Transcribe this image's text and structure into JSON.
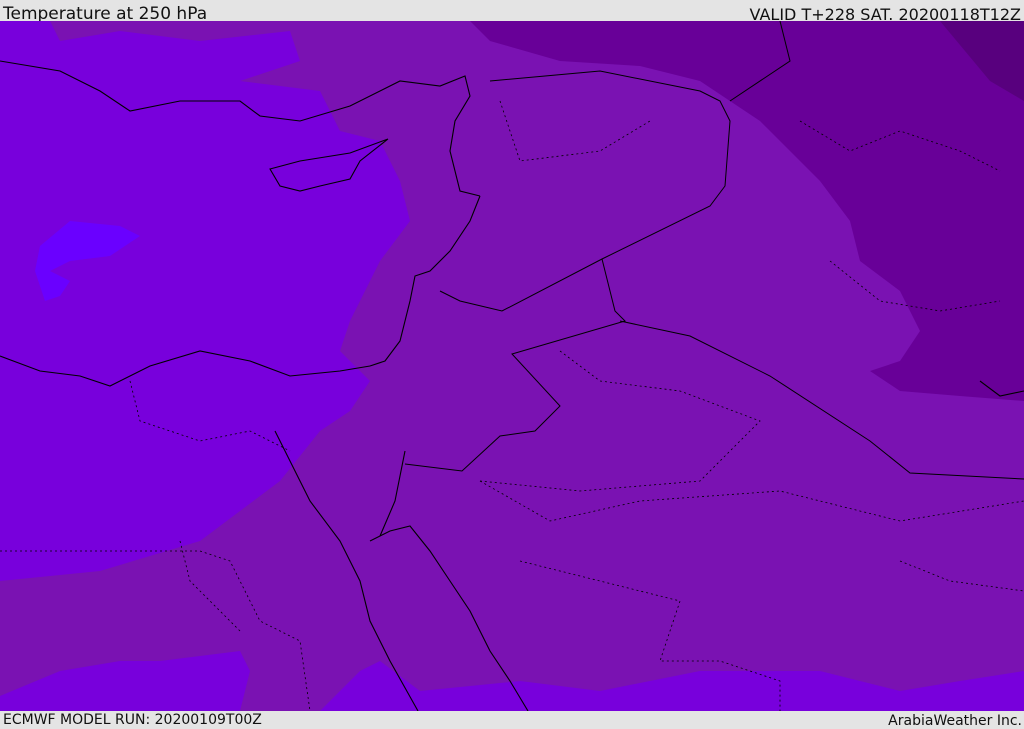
{
  "header": {
    "title": "Temperature at 250 hPa",
    "valid": "VALID T+228 SAT. 20200118T12Z"
  },
  "footer": {
    "model_run": "ECMWF MODEL RUN: 20200109T00Z",
    "brand": "ArabiaWeather Inc."
  },
  "colors": {
    "mid": "#7a12b2",
    "warm_bright": "#7800dc",
    "cold_dark": "#680098",
    "colder": "#58007e",
    "blob": "#6a00ff"
  }
}
